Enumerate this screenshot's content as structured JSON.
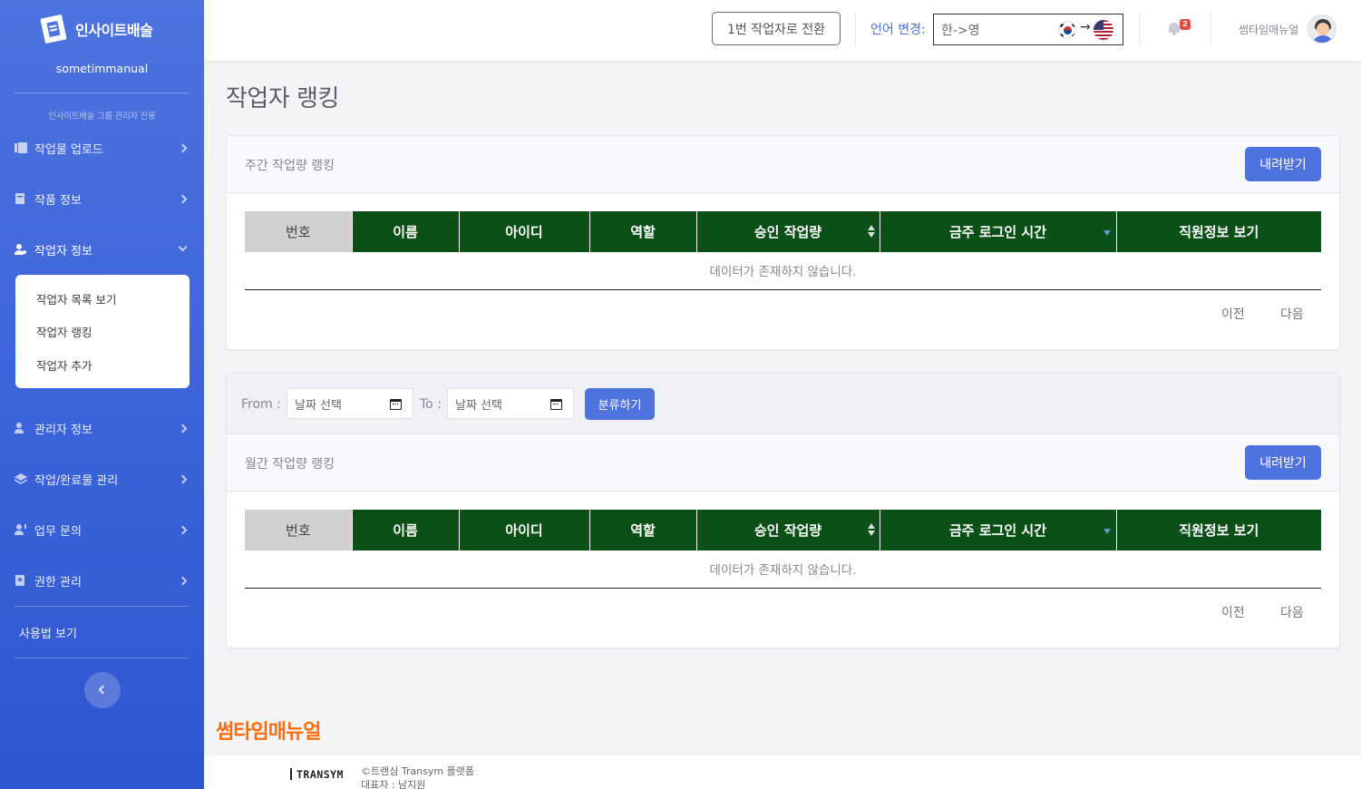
{
  "sidebar": {
    "brand_name": "인사이트배술",
    "brand_sub": "sometimmanual",
    "heading": "인사이트배술 그룹 관리자 전용",
    "items": [
      {
        "label": "작업물 업로드"
      },
      {
        "label": "작품 정보"
      },
      {
        "label": "작업자 정보"
      },
      {
        "label": "관리자 정보"
      },
      {
        "label": "작업/완료물 관리"
      },
      {
        "label": "업무 문의"
      },
      {
        "label": "권한 관리"
      }
    ],
    "submenu": [
      "작업자 목록 보기",
      "작업자 랭킹",
      "작업자 추가"
    ],
    "guide": "사용법 보기"
  },
  "topbar": {
    "switch_label": "1번 작업자로 전환",
    "lang_label": "언어 변경:",
    "lang_value": "한->영",
    "lang_arrow": "→",
    "notification_count": "2",
    "user_name": "썸타임매뉴얼"
  },
  "page": {
    "title": "작업자 랭킹"
  },
  "weekly": {
    "title": "주간 작업량 랭킹",
    "download_label": "내려받기",
    "columns": [
      "번호",
      "이름",
      "아이디",
      "역할",
      "승인 작업량",
      "금주 로그인 시간",
      "직원정보 보기"
    ],
    "empty": "데이터가 존재하지 않습니다.",
    "prev": "이전",
    "next": "다음"
  },
  "monthly": {
    "from_label": "From :",
    "to_label": "To :",
    "from_placeholder": "날짜 선택",
    "to_placeholder": "날짜 선택",
    "filter_label": "분류하기",
    "title": "월간 작업량 랭킹",
    "download_label": "내려받기",
    "columns": [
      "번호",
      "이름",
      "아이디",
      "역할",
      "승인 작업량",
      "금주 로그인 시간",
      "직원정보 보기"
    ],
    "empty": "데이터가 존재하지 않습니다.",
    "prev": "이전",
    "next": "다음"
  },
  "footer": {
    "wordmark": "썸타임매뉴얼",
    "logo": "TRANSYM",
    "copyright": "©트랜심 Transym 플랫폼",
    "ceo": "대표자 : 남지원"
  },
  "colors": {
    "primary": "#4e73df",
    "table_header": "#0b5016",
    "wordmark": "#ff6d0c",
    "badge": "#e74a3b"
  }
}
